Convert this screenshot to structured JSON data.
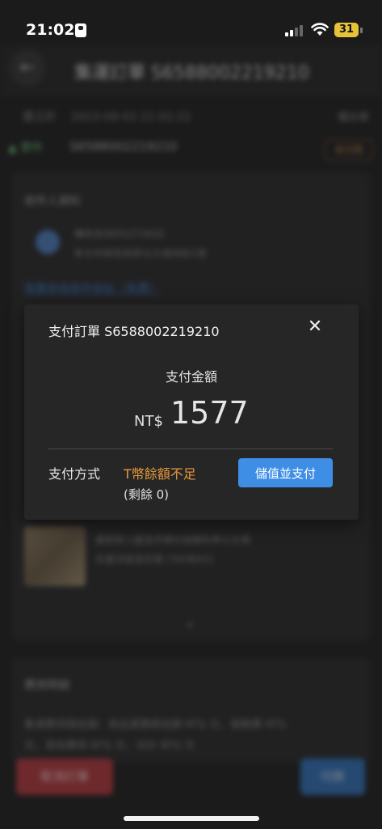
{
  "status_bar": {
    "time": "21:02",
    "battery": "31",
    "battery_color": "#e7c33a"
  },
  "background": {
    "title": "集運訂單 S6588002219210",
    "date_label": "建立於",
    "date": "2023-09-03 21:02:22",
    "date_right": "備註單",
    "status": "寄件",
    "order_number": "S6588002219210",
    "tag": "未付款",
    "section_recipient": "收件人資料",
    "address_line1": "陳先生0931273432",
    "address_line2": "新北市新莊區新北大道四段1號",
    "link": "我要修改收件地址（免費）",
    "item_desc1": "最新款儿童连衣裙长袖春秋季公主裙",
    "item_desc2": "女童洋装连衣裙 (TAOBAO)",
    "section_fee": "費用明細",
    "fee_line1": "集運費用總金額：商品運費總金額 NT$ 元，服務費 NT$",
    "fee_line2": "元，其他費用 NT$ 元，合計 NT$ 元",
    "cancel_button": "取消訂單",
    "pay_button": "付款"
  },
  "dialog": {
    "title": "支付訂單 S6588002219210",
    "amount_label": "支付金額",
    "currency": "NT$",
    "amount": "1577",
    "method_label": "支付方式",
    "insufficient": "T幣餘額不足",
    "remaining": "(剩餘 0)",
    "topup_button": "儲值並支付",
    "close_icon": "close-icon",
    "accent_color": "#3f8ee6",
    "warning_color": "#e79a3c"
  }
}
